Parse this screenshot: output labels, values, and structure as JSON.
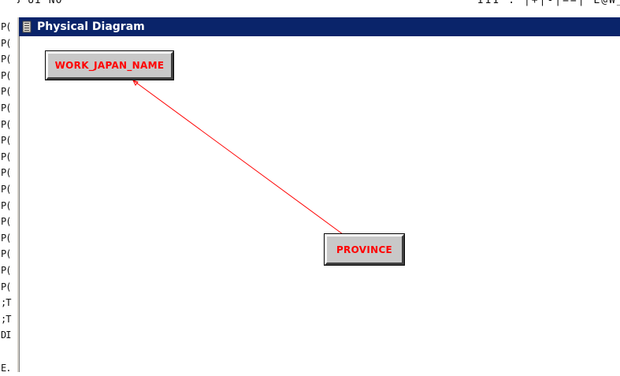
{
  "background_app": {
    "top_left_text": "'UB UI NO",
    "top_right_text": "III : |+|-|==| L@W_UL UP",
    "left_rows": [
      "P(",
      "P(",
      "P(",
      "P(",
      "P(",
      "P(",
      "P(",
      "P(",
      "P(",
      "P(",
      "P(",
      "P(",
      "P(",
      "P(",
      "P(",
      "P(",
      "P(",
      ";T",
      ";T",
      "DI",
      "",
      "E."
    ]
  },
  "window": {
    "title": "Physical Diagram",
    "icon": "document-icon",
    "titlebar_color": "#0a246a"
  },
  "diagram": {
    "entities": [
      {
        "name": "WORK_JAPAN_NAME"
      },
      {
        "name": "PROVINCE"
      }
    ],
    "relationship": {
      "from": "PROVINCE",
      "to": "WORK_JAPAN_NAME",
      "color": "#ff0000"
    }
  }
}
